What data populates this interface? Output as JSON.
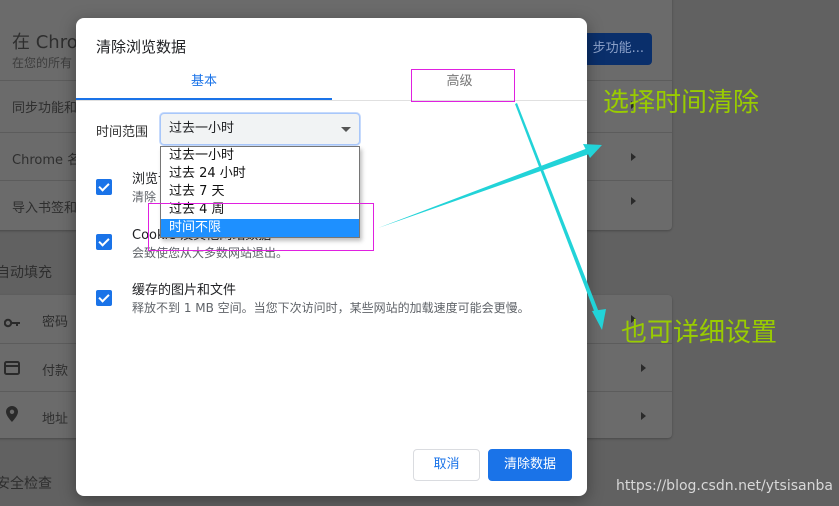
{
  "background": {
    "header_title": "在 Chrome",
    "header_subtitle": "在您的所有",
    "sync_button": "步功能...",
    "rows": [
      "同步功能和",
      "Chrome 名称",
      "导入书签和"
    ],
    "autofill_section": "自动填充",
    "autofill_rows": [
      {
        "icon": "key-icon",
        "label": "密码"
      },
      {
        "icon": "credit-card-icon",
        "label": "付款"
      },
      {
        "icon": "location-pin-icon",
        "label": "地址"
      }
    ],
    "safety_section": "安全检查"
  },
  "dialog": {
    "title": "清除浏览数据",
    "tabs": [
      {
        "label": "基本",
        "active": true
      },
      {
        "label": "高级",
        "active": false
      }
    ],
    "time_range_label": "时间范围",
    "time_range_value": "过去一小时",
    "time_range_options": [
      "过去一小时",
      "过去 24 小时",
      "过去 7 天",
      "过去 4 周",
      "时间不限"
    ],
    "highlighted_option": "时间不限",
    "items": [
      {
        "title": "浏览记录",
        "subtitle": "清除",
        "checked": true
      },
      {
        "title": "Cookie 及其他网站数据",
        "subtitle": "会致使您从大多数网站退出。",
        "checked": true
      },
      {
        "title": "缓存的图片和文件",
        "subtitle": "释放不到 1 MB 空间。当您下次访问时，某些网站的加载速度可能会更慢。",
        "checked": true
      }
    ],
    "cancel_button": "取消",
    "clear_button": "清除数据"
  },
  "annotations": {
    "select_time": "选择时间清除",
    "advanced_settings": "也可详细设置",
    "arrow_color": "#22d3d8",
    "box_color": "#e020e0",
    "text_color": "#99cc00"
  },
  "watermark": "https://blog.csdn.net/ytsisanba"
}
